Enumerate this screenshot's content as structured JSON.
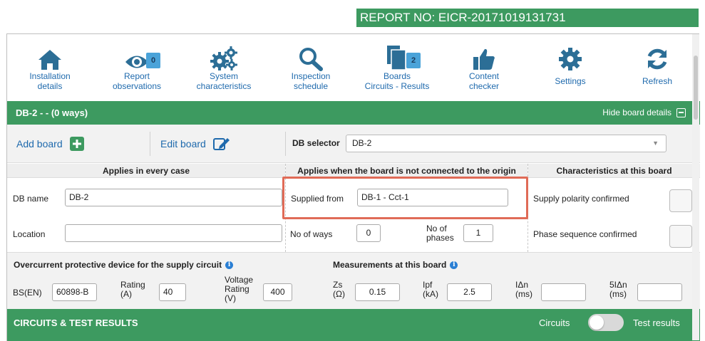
{
  "report": {
    "number": "REPORT NO: EICR-20171019131731"
  },
  "toolbar": {
    "installation": {
      "line1": "Installation",
      "line2": "details"
    },
    "observations": {
      "line1": "Report",
      "line2": "observations",
      "badge": "0"
    },
    "system": {
      "line1": "System",
      "line2": "characteristics"
    },
    "inspection": {
      "line1": "Inspection",
      "line2": "schedule"
    },
    "boards": {
      "line1": "Boards",
      "line2": "Circuits - Results",
      "badge": "2"
    },
    "content": {
      "line1": "Content",
      "line2": "checker"
    },
    "settings": {
      "label": "Settings"
    },
    "refresh": {
      "label": "Refresh"
    }
  },
  "board": {
    "title": "DB-2 -  - (0 ways)",
    "hide_label": "Hide board details",
    "add_board": "Add board",
    "edit_board": "Edit board",
    "db_selector_label": "DB selector",
    "db_selector_value": "DB-2"
  },
  "columns": {
    "every_case": "Applies in every case",
    "not_connected": "Applies when the board is not connected to the origin",
    "characteristics": "Characteristics at this board"
  },
  "fields": {
    "db_name_label": "DB name",
    "db_name_value": "DB-2",
    "location_label": "Location",
    "location_value": "",
    "supplied_from_label": "Supplied from",
    "supplied_from_value": "DB-1 - Cct-1",
    "no_of_ways_label": "No of ways",
    "no_of_ways_value": "0",
    "no_of_phases_label1": "No of",
    "no_of_phases_label2": "phases",
    "no_of_phases_value": "1",
    "supply_polarity_label": "Supply polarity confirmed",
    "phase_sequence_label": "Phase sequence confirmed"
  },
  "overcurrent": {
    "title": "Overcurrent protective device for the supply circuit",
    "bsen_label": "BS(EN)",
    "bsen_value": "60898-B",
    "rating_label1": "Rating",
    "rating_label2": "(A)",
    "rating_value": "40",
    "voltage_label1": "Voltage",
    "voltage_label2": "Rating",
    "voltage_label3": "(V)",
    "voltage_value": "400"
  },
  "measurements": {
    "title": "Measurements at this board",
    "zs_label1": "Zs",
    "zs_label2": "(Ω)",
    "zs_value": "0.15",
    "ipf_label1": "Ipf",
    "ipf_label2": "(kA)",
    "ipf_value": "2.5",
    "idn_label1": "IΔn",
    "idn_label2": "(ms)",
    "idn_value": "",
    "idn5_label1": "5IΔn",
    "idn5_label2": "(ms)",
    "idn5_value": ""
  },
  "circuits": {
    "title": "CIRCUITS & TEST RESULTS",
    "circuits_label": "Circuits",
    "test_results_label": "Test results"
  },
  "colors": {
    "accent_green": "#3d9a60",
    "link_blue": "#1f6aad",
    "highlight_red": "#e06b57"
  }
}
